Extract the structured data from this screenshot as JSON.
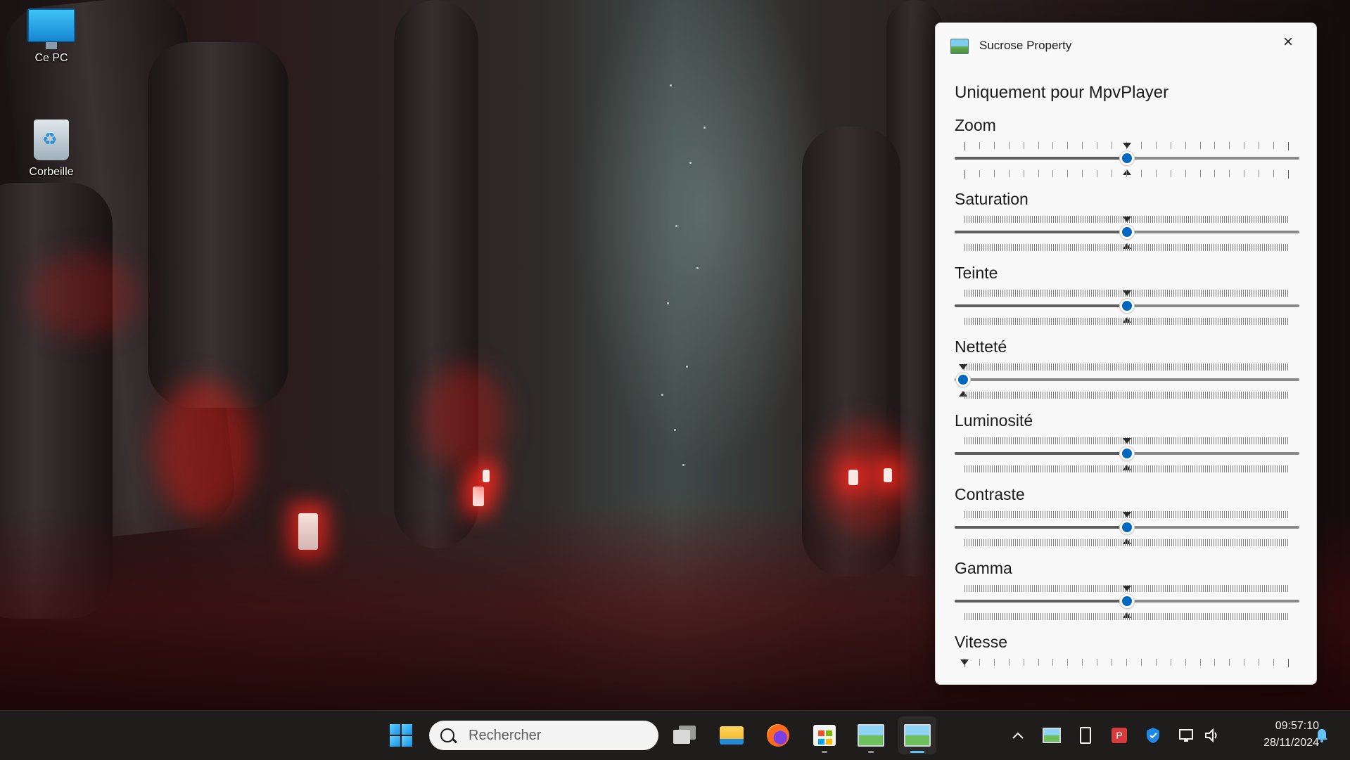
{
  "desktop": {
    "icons": [
      {
        "label": "Ce PC",
        "icon": "computer-icon"
      },
      {
        "label": "Corbeille",
        "icon": "recycle-bin-icon"
      }
    ]
  },
  "dialog": {
    "title": "Sucrose Property",
    "close_icon": "×",
    "heading": "Uniquement pour MpvPlayer",
    "sliders": [
      {
        "label": "Zoom",
        "value_percent": 50
      },
      {
        "label": "Saturation",
        "value_percent": 50
      },
      {
        "label": "Teinte",
        "value_percent": 50
      },
      {
        "label": "Netteté",
        "value_percent": 0
      },
      {
        "label": "Luminosité",
        "value_percent": 50
      },
      {
        "label": "Contraste",
        "value_percent": 50
      },
      {
        "label": "Gamma",
        "value_percent": 50
      },
      {
        "label": "Vitesse"
      }
    ]
  },
  "taskbar": {
    "search_placeholder": "Rechercher",
    "apps": [
      "start-icon",
      "task-view-icon",
      "file-explorer-icon",
      "firefox-icon",
      "microsoft-store-icon",
      "sucrose-icon",
      "sucrose-property-icon"
    ],
    "tray": [
      "chevron-up-icon",
      "sucrose-tray-icon",
      "usb-icon",
      "powerpoint-icon",
      "security-shield-icon",
      "network-icon",
      "volume-icon",
      "notification-bell-icon"
    ],
    "time": "09:57:10",
    "date": "28/11/2024"
  },
  "colors": {
    "accent": "#0067c0",
    "taskbar_bg": "#1f1c1c",
    "dialog_bg": "#f9f9f9"
  }
}
